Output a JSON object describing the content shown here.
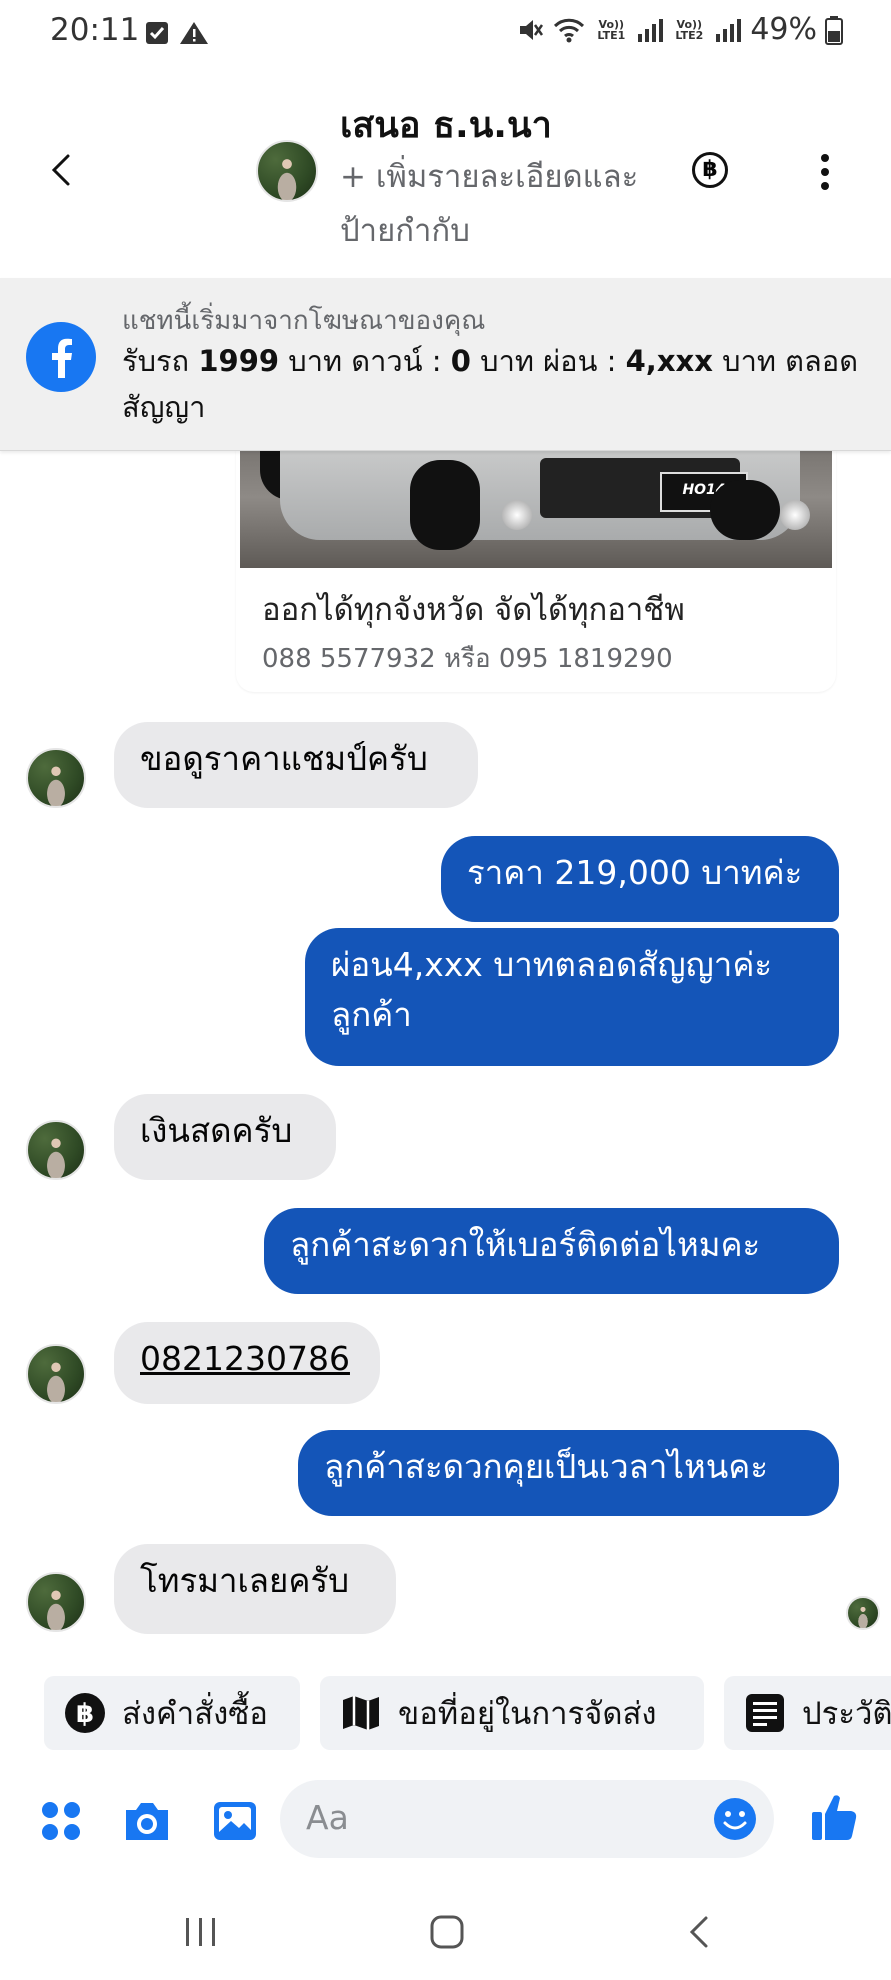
{
  "status": {
    "time": "20:11",
    "battery": "49%",
    "sim1": "Vo)) LTE1",
    "sim2": "Vo)) LTE2"
  },
  "header": {
    "contact_name": "เสนอ ธ.น.นา",
    "add_details": "+ เพิ่มรายละเอียดและป้ายกำกับ",
    "baht_symbol": "฿"
  },
  "ad_banner": {
    "label": "แชทนี้เริ่มมาจากโฆษณาของคุณ",
    "text_parts": [
      "รับรถ ",
      "1999",
      " บาท ดาวน์ : ",
      "0",
      " บาท ผ่อน : ",
      "4,xxx",
      " บาท ตลอดสัญญา"
    ]
  },
  "ad_card": {
    "plate": "HO14",
    "title": "ออกได้ทุกจังหวัด จัดได้ทุกอาชีพ",
    "subtitle": "088 5577932 หรือ 095 1819290"
  },
  "messages": [
    {
      "dir": "in",
      "text": "ขอดูราคาแชมป์ครับ"
    },
    {
      "dir": "out",
      "text": "ราคา 219,000 บาทค่ะ"
    },
    {
      "dir": "out",
      "text": "ผ่อน4,xxx บาทตลอดสัญญาค่ะ ลูกค้า"
    },
    {
      "dir": "in",
      "text": "เงินสดครับ"
    },
    {
      "dir": "out",
      "text": "ลูกค้าสะดวกให้เบอร์ติดต่อไหมคะ"
    },
    {
      "dir": "in",
      "text": "0821230786"
    },
    {
      "dir": "out",
      "text": "ลูกค้าสะดวกคุยเป็นเวลาไหนคะ"
    },
    {
      "dir": "in",
      "text": "โทรมาเลยครับ"
    }
  ],
  "quick_replies": [
    {
      "label": "ส่งคำสั่งซื้อ",
      "icon": "baht-icon"
    },
    {
      "label": "ขอที่อยู่ในการจัดส่ง",
      "icon": "map-icon"
    },
    {
      "label": "ประวัติ",
      "icon": "list-icon"
    }
  ],
  "composer": {
    "placeholder": "Aa"
  },
  "colors": {
    "outgoing_bubble": "#1455b8",
    "incoming_bubble": "#e9e9eb",
    "accent": "#1877f2"
  }
}
